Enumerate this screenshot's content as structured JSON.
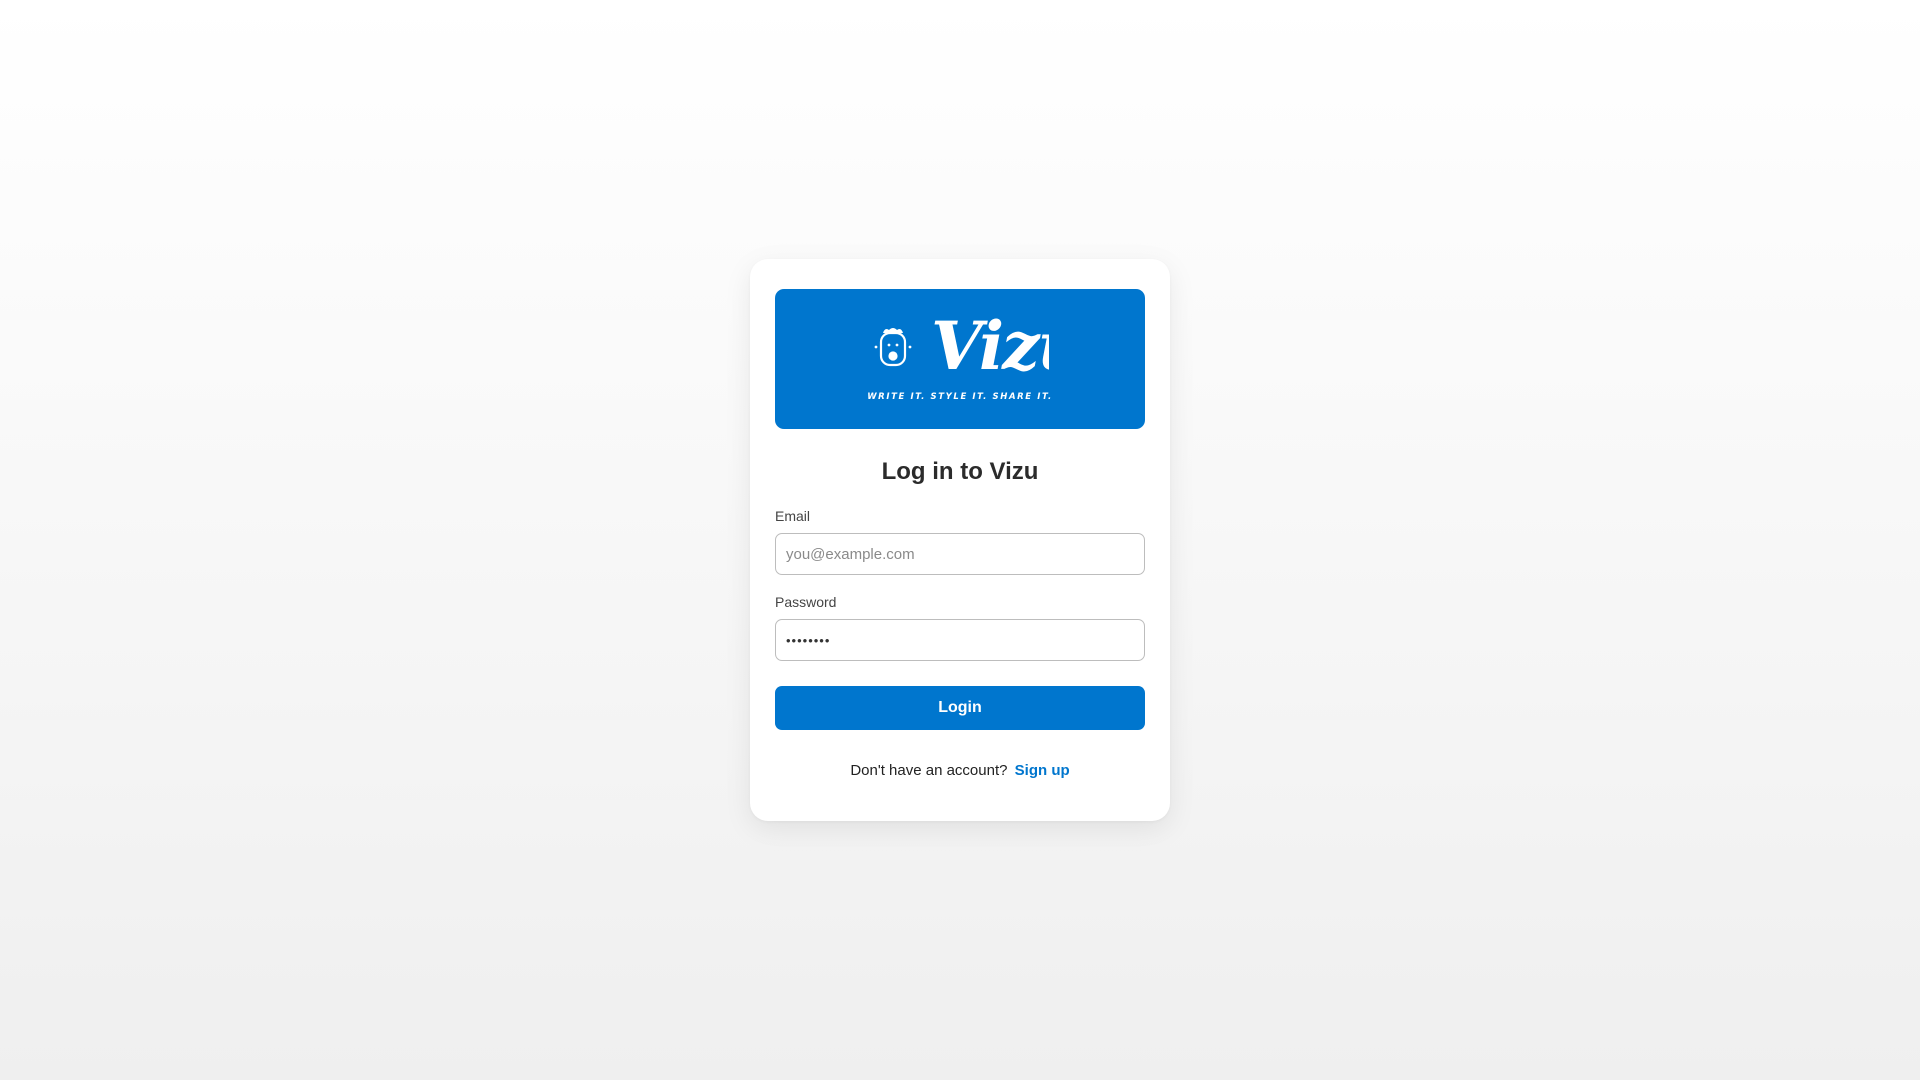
{
  "brand": {
    "name": "Vizu",
    "tagline": "WRITE IT. STYLE IT. SHARE IT.",
    "banner_color": "#0076ce",
    "mascot_icon": "mascot-icon"
  },
  "login": {
    "title": "Log in to Vizu",
    "email_label": "Email",
    "email_placeholder": "you@example.com",
    "email_value": "",
    "password_label": "Password",
    "password_value": "secret12",
    "submit_label": "Login"
  },
  "signup": {
    "prompt": "Don't have an account?",
    "link_label": "Sign up"
  },
  "colors": {
    "accent": "#0076ce",
    "text": "#2b2b2b"
  }
}
